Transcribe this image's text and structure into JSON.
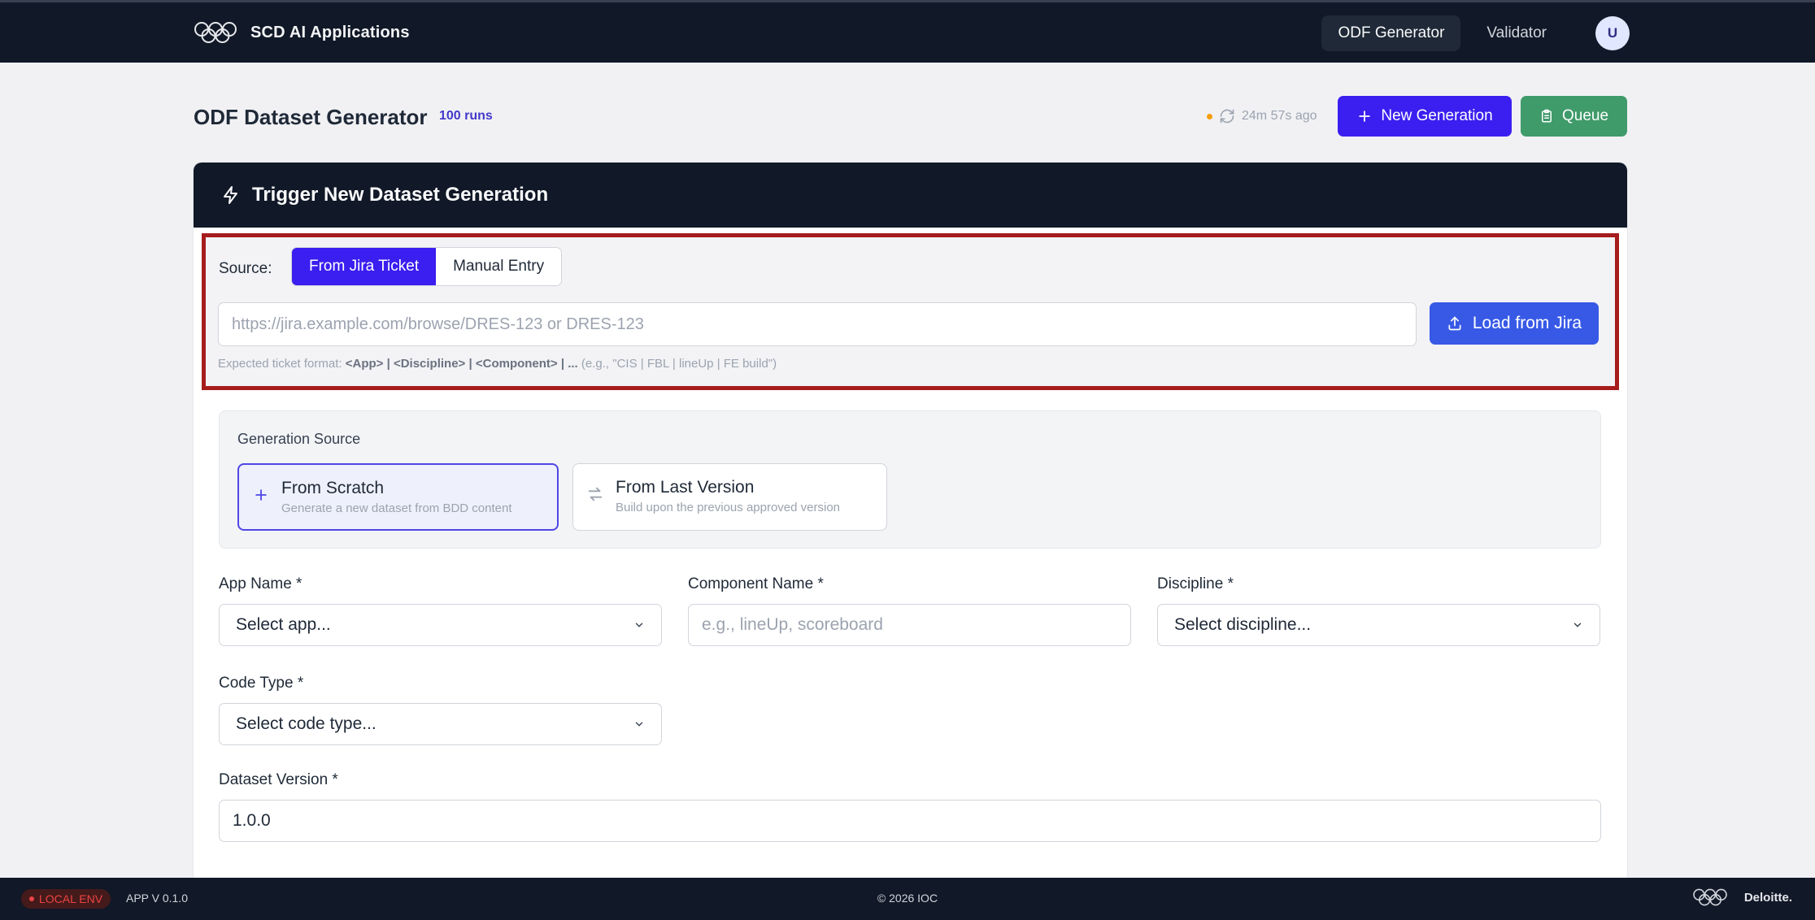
{
  "header": {
    "brand_title": "SCD AI Applications",
    "nav": [
      {
        "label": "ODF Generator",
        "active": true
      },
      {
        "label": "Validator",
        "active": false
      }
    ],
    "avatar_initial": "U"
  },
  "page": {
    "title": "ODF Dataset Generator",
    "runs_badge": "100 runs",
    "last_refresh": "24m 57s ago",
    "new_generation_label": "New Generation",
    "queue_label": "Queue"
  },
  "card": {
    "title": "Trigger New Dataset Generation",
    "source": {
      "label": "Source:",
      "options": [
        "From Jira Ticket",
        "Manual Entry"
      ],
      "selected": "From Jira Ticket"
    },
    "jira_input": {
      "value": "",
      "placeholder": "https://jira.example.com/browse/DRES-123 or DRES-123"
    },
    "load_button": "Load from Jira",
    "hint": {
      "prefix": "Expected ticket format: ",
      "format": "<App> | <Discipline> | <Component> | ...",
      "example": " (e.g., \"CIS | FBL | lineUp | FE build\")"
    },
    "generation_source": {
      "label": "Generation Source",
      "options": [
        {
          "title": "From Scratch",
          "desc": "Generate a new dataset from BDD content",
          "icon": "plus-icon",
          "selected": true
        },
        {
          "title": "From Last Version",
          "desc": "Build upon the previous approved version",
          "icon": "swap-arrows-icon",
          "selected": false
        }
      ]
    },
    "fields": {
      "app_name": {
        "label": "App Name *",
        "placeholder": "Select app..."
      },
      "component_name": {
        "label": "Component Name *",
        "placeholder": "e.g., lineUp, scoreboard"
      },
      "discipline": {
        "label": "Discipline *",
        "placeholder": "Select discipline..."
      },
      "code_type": {
        "label": "Code Type *",
        "placeholder": "Select code type..."
      },
      "dataset_version": {
        "label": "Dataset Version *",
        "value": "1.0.0"
      }
    }
  },
  "footer": {
    "env_badge": "LOCAL ENV",
    "app_version": "APP V 0.1.0",
    "copyright": "© 2026 IOC",
    "partner": "Deloitte."
  },
  "colors": {
    "primary": "#3b1ef0",
    "success": "#3f9b6a",
    "load_button": "#3759e6",
    "dark": "#111827",
    "highlight_border": "#a61c1c"
  }
}
